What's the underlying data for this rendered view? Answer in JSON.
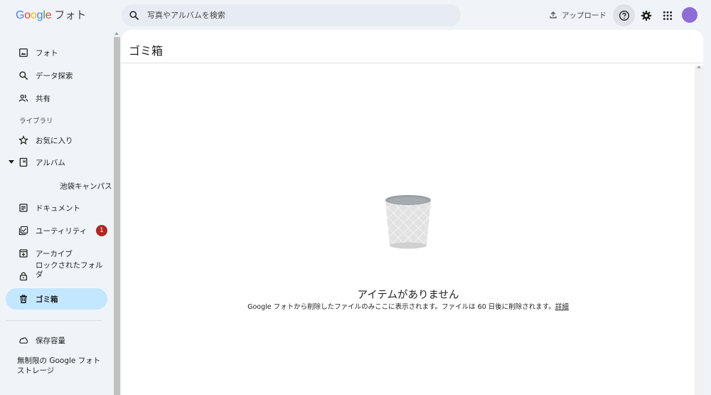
{
  "header": {
    "logo_google": "Google",
    "logo_product": "フォト",
    "search_placeholder": "写真やアルバムを検索",
    "upload_label": "アップロード",
    "brand_colors": {
      "blue": "#4285f4",
      "red": "#ea4335",
      "yellow": "#fbbc05",
      "green": "#34a853"
    },
    "avatar_color": "#8e6bd6"
  },
  "sidebar": {
    "items": [
      {
        "label": "フォト",
        "icon": "photo-icon"
      },
      {
        "label": "データ探索",
        "icon": "search-icon"
      },
      {
        "label": "共有",
        "icon": "people-icon"
      }
    ],
    "library_label": "ライブラリ",
    "library_items": [
      {
        "label": "お気に入り",
        "icon": "star-icon"
      },
      {
        "label": "アルバム",
        "icon": "album-icon"
      }
    ],
    "album_sub": "池袋キャンパス",
    "more_items": [
      {
        "label": "ドキュメント",
        "icon": "document-icon"
      },
      {
        "label": "ユーティリティ",
        "icon": "utilities-icon",
        "badge": "1"
      },
      {
        "label": "アーカイブ",
        "icon": "archive-icon"
      },
      {
        "label": "ロックされたフォルダ",
        "icon": "lock-icon"
      },
      {
        "label": "ゴミ箱",
        "icon": "trash-icon",
        "active": true
      }
    ],
    "storage_label": "保存容量",
    "storage_note": "無制限の Google フォト ストレージ",
    "active_color": "#c2e7ff",
    "badge_color": "#b3261e"
  },
  "main": {
    "title": "ゴミ箱",
    "empty_title": "アイテムがありません",
    "empty_desc": "Google フォトから削除したファイルのみここに表示されます。ファイルは 60 日後に削除されます。",
    "learn_more": "詳細"
  }
}
